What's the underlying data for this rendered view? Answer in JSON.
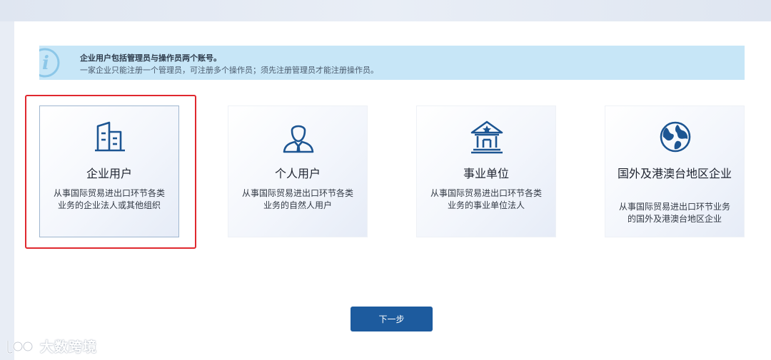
{
  "notice": {
    "icon": "info-icon",
    "line1": "企业用户包括管理员与操作员两个账号。",
    "line2": "一家企业只能注册一个管理员，可注册多个操作员；须先注册管理员才能注册操作员。"
  },
  "cards": [
    {
      "icon": "building-icon",
      "title": "企业用户",
      "desc": "从事国际贸易进出口环节各类业务的企业法人或其他组织",
      "selected": true
    },
    {
      "icon": "person-icon",
      "title": "个人用户",
      "desc": "从事国际贸易进出口环节各类业务的自然人用户",
      "selected": false
    },
    {
      "icon": "institution-icon",
      "title": "事业单位",
      "desc": "从事国际贸易进出口环节各类业务的事业单位法人",
      "selected": false
    },
    {
      "icon": "globe-icon",
      "title": "国外及港澳台地区企业",
      "desc": "从事国际贸易进出口环节业务的国外及港澳台地区企业",
      "selected": false
    }
  ],
  "next_button": {
    "label": "下一步"
  },
  "watermark": {
    "text": "大数跨境"
  },
  "colors": {
    "primary": "#1d5b9e",
    "icon": "#1c5592",
    "notice_bg": "#c7e6f7",
    "selection": "#e0282e"
  }
}
